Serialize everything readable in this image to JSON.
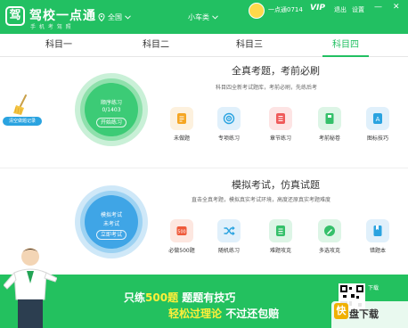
{
  "header": {
    "logo_char": "驾",
    "app_name": "驾校一点通",
    "app_subtitle": "手 机 考 驾 照",
    "region": "全国",
    "vehicle": "小车类",
    "username": "一点通0714",
    "vip": "VIP",
    "logout": "退出",
    "settings": "设置",
    "minimize": "—",
    "close": "✕",
    "colors": {
      "brand": "#22c062",
      "accent_blue": "#2aa3e0"
    }
  },
  "tabs": [
    {
      "label": "科目一",
      "active": false
    },
    {
      "label": "科目二",
      "active": false
    },
    {
      "label": "科目三",
      "active": false
    },
    {
      "label": "科目四",
      "active": true
    }
  ],
  "practice": {
    "title": "全真考题，考前必刷",
    "desc": "科目四全新考试题库，考前必刷，先练后考",
    "circle_label": "顺序练习",
    "progress_text": "0/1403",
    "progress_fraction": 0.0,
    "button": "开始练习",
    "clear_records": "清空做题记录",
    "features": [
      {
        "label": "未做题",
        "icon": "note-icon",
        "color": "#f5a623"
      },
      {
        "label": "专项练习",
        "icon": "target-icon",
        "color": "#2aa3e0"
      },
      {
        "label": "章节练习",
        "icon": "list-icon",
        "color": "#ef5a5a"
      },
      {
        "label": "考前秘卷",
        "icon": "secret-book-icon",
        "color": "#35c06a"
      },
      {
        "label": "图标技巧",
        "icon": "image-icon",
        "color": "#2aa3e0"
      }
    ]
  },
  "exam": {
    "title": "模拟考试，仿真试题",
    "desc": "直击全真考题，模拟真实考试环境，高度还原真实考题难度",
    "circle_label": "模拟考试",
    "status": "未考试",
    "button": "立即考试",
    "features": [
      {
        "label": "必做500题",
        "icon": "500-icon",
        "color": "#ef5a3a",
        "badge": "500"
      },
      {
        "label": "随机练习",
        "icon": "shuffle-icon",
        "color": "#2aa3e0"
      },
      {
        "label": "难题攻克",
        "icon": "tag-icon",
        "color": "#35c06a"
      },
      {
        "label": "多选攻克",
        "icon": "pen-icon",
        "color": "#35c06a"
      },
      {
        "label": "错题本",
        "icon": "book-icon",
        "color": "#2aa3e0"
      }
    ]
  },
  "banner": {
    "line1_prefix": "只练",
    "line1_highlight": "500题",
    "line1_suffix": " 题题有技巧",
    "line2_highlight": "轻松过理论",
    "line2_suffix": " 不过还包赔",
    "qr_label": "下载",
    "watermark": "盘下载",
    "watermark_icon": "快"
  }
}
